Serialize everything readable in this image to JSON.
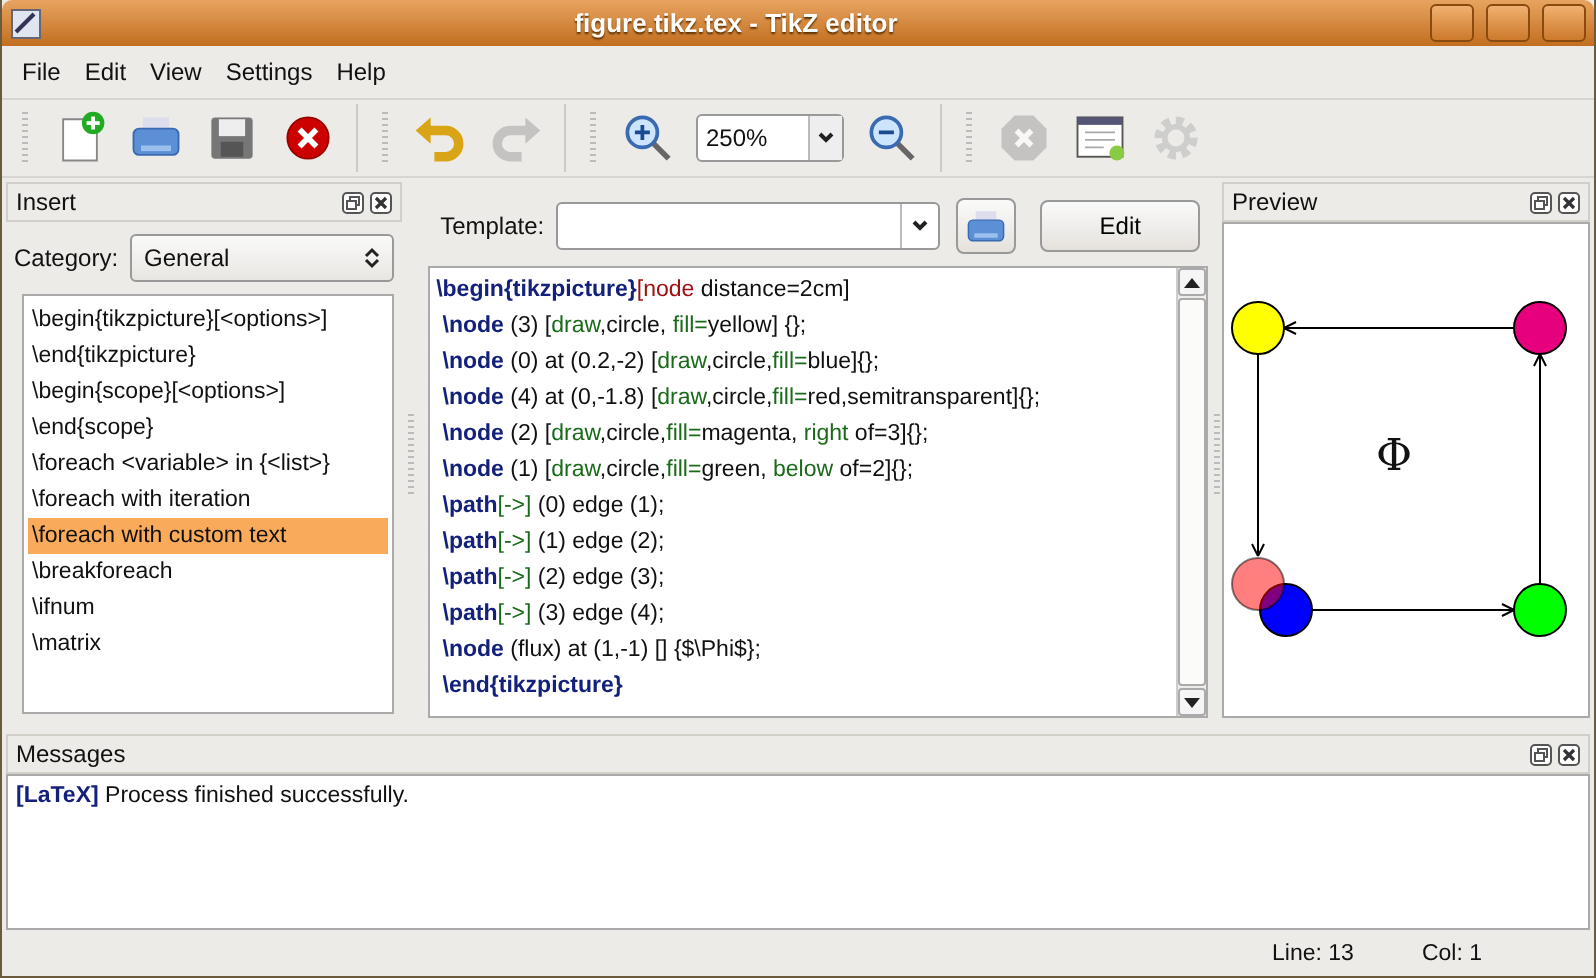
{
  "window": {
    "title": "figure.tikz.tex - TikZ editor"
  },
  "menu": [
    "File",
    "Edit",
    "View",
    "Settings",
    "Help"
  ],
  "toolbar": [
    {
      "kind": "new",
      "disabled": false
    },
    {
      "kind": "print",
      "disabled": false
    },
    {
      "kind": "save",
      "disabled": false
    },
    {
      "kind": "close",
      "disabled": false
    },
    {
      "kind": "sep"
    },
    {
      "kind": "undo",
      "disabled": false
    },
    {
      "kind": "redo",
      "disabled": true
    },
    {
      "kind": "sep"
    },
    {
      "kind": "zoomin",
      "disabled": false
    },
    {
      "kind": "zoom",
      "value": "250%"
    },
    {
      "kind": "zoomout",
      "disabled": false
    },
    {
      "kind": "sep"
    },
    {
      "kind": "stop",
      "disabled": true
    },
    {
      "kind": "window",
      "disabled": false
    },
    {
      "kind": "gear",
      "disabled": true
    }
  ],
  "insert_panel": {
    "title": "Insert",
    "category_label": "Category:",
    "category": "General",
    "items": [
      {
        "label": "\\begin{tikzpicture}[<options>]",
        "selected": false
      },
      {
        "label": "\\end{tikzpicture}",
        "selected": false
      },
      {
        "label": "\\begin{scope}[<options>]",
        "selected": false
      },
      {
        "label": "\\end{scope}",
        "selected": false
      },
      {
        "label": "\\foreach <variable> in {<list>}",
        "selected": false
      },
      {
        "label": "\\foreach with iteration",
        "selected": false
      },
      {
        "label": "\\foreach with custom text",
        "selected": true
      },
      {
        "label": "\\breakforeach",
        "selected": false
      },
      {
        "label": "\\ifnum",
        "selected": false
      },
      {
        "label": "\\matrix",
        "selected": false
      }
    ]
  },
  "editor": {
    "template_label": "Template:",
    "edit_button": "Edit",
    "lines": [
      [
        {
          "kind": "cmd",
          "text": "\\begin{tikzpicture}"
        },
        {
          "kind": "key",
          "text": "[node"
        },
        {
          "kind": "text",
          "text": " distance=2cm]"
        }
      ],
      [
        {
          "kind": "cmd",
          "text": " \\node"
        },
        {
          "kind": "text",
          "text": " (3) ["
        },
        {
          "kind": "opt",
          "text": "draw"
        },
        {
          "kind": "text",
          "text": ",circle, "
        },
        {
          "kind": "opt",
          "text": "fill="
        },
        {
          "kind": "text",
          "text": "yellow] {};"
        }
      ],
      [
        {
          "kind": "cmd",
          "text": " \\node"
        },
        {
          "kind": "text",
          "text": " (0) at (0.2,-2) ["
        },
        {
          "kind": "opt",
          "text": "draw"
        },
        {
          "kind": "text",
          "text": ",circle,"
        },
        {
          "kind": "opt",
          "text": "fill="
        },
        {
          "kind": "text",
          "text": "blue]{};"
        }
      ],
      [
        {
          "kind": "cmd",
          "text": " \\node"
        },
        {
          "kind": "text",
          "text": " (4) at (0,-1.8) ["
        },
        {
          "kind": "opt",
          "text": "draw"
        },
        {
          "kind": "text",
          "text": ",circle,"
        },
        {
          "kind": "opt",
          "text": "fill="
        },
        {
          "kind": "text",
          "text": "red,semitransparent]{};"
        }
      ],
      [
        {
          "kind": "cmd",
          "text": " \\node"
        },
        {
          "kind": "text",
          "text": " (2) ["
        },
        {
          "kind": "opt",
          "text": "draw"
        },
        {
          "kind": "text",
          "text": ",circle,"
        },
        {
          "kind": "opt",
          "text": "fill="
        },
        {
          "kind": "text",
          "text": "magenta, "
        },
        {
          "kind": "opt",
          "text": "right"
        },
        {
          "kind": "text",
          "text": " of=3]{};"
        }
      ],
      [
        {
          "kind": "cmd",
          "text": " \\node"
        },
        {
          "kind": "text",
          "text": " (1) ["
        },
        {
          "kind": "opt",
          "text": "draw"
        },
        {
          "kind": "text",
          "text": ",circle,"
        },
        {
          "kind": "opt",
          "text": "fill="
        },
        {
          "kind": "text",
          "text": "green, "
        },
        {
          "kind": "opt",
          "text": "below"
        },
        {
          "kind": "text",
          "text": " of=2]{};"
        }
      ],
      [
        {
          "kind": "cmd",
          "text": " \\path"
        },
        {
          "kind": "opt",
          "text": "[->]"
        },
        {
          "kind": "text",
          "text": " (0) edge (1);"
        }
      ],
      [
        {
          "kind": "cmd",
          "text": " \\path"
        },
        {
          "kind": "opt",
          "text": "[->]"
        },
        {
          "kind": "text",
          "text": " (1) edge (2);"
        }
      ],
      [
        {
          "kind": "cmd",
          "text": " \\path"
        },
        {
          "kind": "opt",
          "text": "[->]"
        },
        {
          "kind": "text",
          "text": " (2) edge (3);"
        }
      ],
      [
        {
          "kind": "cmd",
          "text": " \\path"
        },
        {
          "kind": "opt",
          "text": "[->]"
        },
        {
          "kind": "text",
          "text": " (3) edge (4);"
        }
      ],
      [
        {
          "kind": "cmd",
          "text": " \\node"
        },
        {
          "kind": "text",
          "text": " (flux) at (1,-1) [] {$\\Phi$};"
        }
      ],
      [
        {
          "kind": "cmd",
          "text": " \\end{tikzpicture}"
        }
      ]
    ]
  },
  "preview": {
    "title": "Preview",
    "label": "Φ"
  },
  "messages": {
    "title": "Messages",
    "tag": "[LaTeX]",
    "text": "Process finished successfully."
  },
  "status_bar": {
    "line": "Line: 13",
    "col": "Col: 1"
  }
}
